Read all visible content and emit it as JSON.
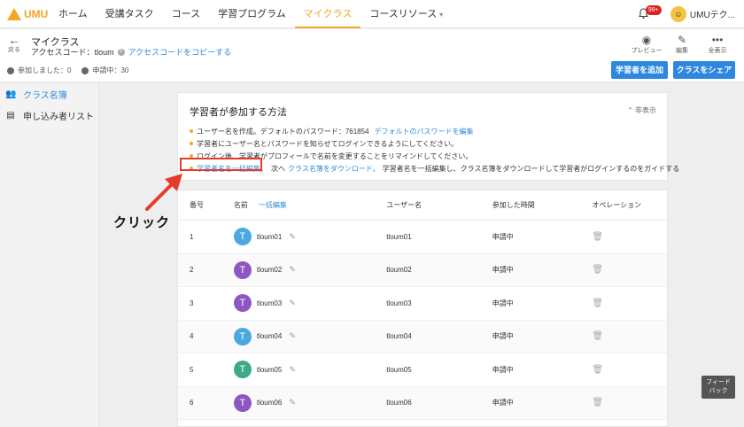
{
  "brand": {
    "name": "UMU"
  },
  "nav": {
    "items": [
      "ホーム",
      "受講タスク",
      "コース",
      "学習プログラム",
      "マイクラス",
      "コースリソース"
    ],
    "active_index": 4,
    "notifications_badge": "99+",
    "user_name": "UMUテク...",
    "colors": {
      "accent": "#f5a623",
      "primary": "#2d87e0"
    }
  },
  "header": {
    "back_label": "戻る",
    "title": "マイクラス",
    "access_code_label": "アクセスコード：",
    "access_code": "tloum",
    "copy_link": "アクセスコードをコピーする",
    "stat_joined": "参加しました：0",
    "stat_applying": "申請中：30",
    "tools": [
      {
        "icon": "eye-icon",
        "label": "プレビュー"
      },
      {
        "icon": "edit-icon",
        "label": "編集"
      },
      {
        "icon": "more-icon",
        "label": "全表示"
      }
    ],
    "add_learner_button": "学習者を追加",
    "share_class_button": "クラスをシェア"
  },
  "sidebar": {
    "items": [
      {
        "label": "クラス名簿",
        "icon": "users-icon",
        "active": true
      },
      {
        "label": "申し込み者リスト",
        "icon": "list-icon",
        "active": false
      }
    ]
  },
  "info_card": {
    "title": "学習者が参加する方法",
    "hide_label": "非表示",
    "step1_text": "ユーザー名を作成。デフォルトのパスワード：761854",
    "step1_link": "デフォルトのパスワードを編集",
    "step2_text": "学習者にユーザー名とパスワードを知らせてログインできるようにしてください。",
    "step3_text": "ログイン後、学習者がプロフィールで名前を変更することをリマインドしてください。",
    "step4_link1": "学習者名を一括編集。",
    "step4_mid": "次へ",
    "step4_link2": "クラス名簿をダウンロード。",
    "step4_tail": "学習者名を一括編集し、クラス名簿をダウンロードして学習者がログインするのをガイドする"
  },
  "annotation": {
    "click_label": "クリック"
  },
  "table": {
    "headers": {
      "number": "番号",
      "name": "名前",
      "bulk_edit": "一括編集",
      "username": "ユーザー名",
      "join_time": "参加した時間",
      "operation": "オペレーション"
    },
    "rows": [
      {
        "no": "1",
        "initial": "T",
        "name": "tloum01",
        "username": "tloum01",
        "status": "申請中",
        "color": "#4aa8e0"
      },
      {
        "no": "2",
        "initial": "T",
        "name": "tloum02",
        "username": "tloum02",
        "status": "申請中",
        "color": "#8e56c2"
      },
      {
        "no": "3",
        "initial": "T",
        "name": "tloum03",
        "username": "tloum03",
        "status": "申請中",
        "color": "#8e56c2"
      },
      {
        "no": "4",
        "initial": "T",
        "name": "tloum04",
        "username": "tloum04",
        "status": "申請中",
        "color": "#4aa8e0"
      },
      {
        "no": "5",
        "initial": "T",
        "name": "tloum05",
        "username": "tloum05",
        "status": "申請中",
        "color": "#3fa88a"
      },
      {
        "no": "6",
        "initial": "T",
        "name": "tloum06",
        "username": "tloum06",
        "status": "申請中",
        "color": "#8e56c2"
      }
    ]
  },
  "feedback": {
    "line1": "フィード",
    "line2": "バック"
  }
}
